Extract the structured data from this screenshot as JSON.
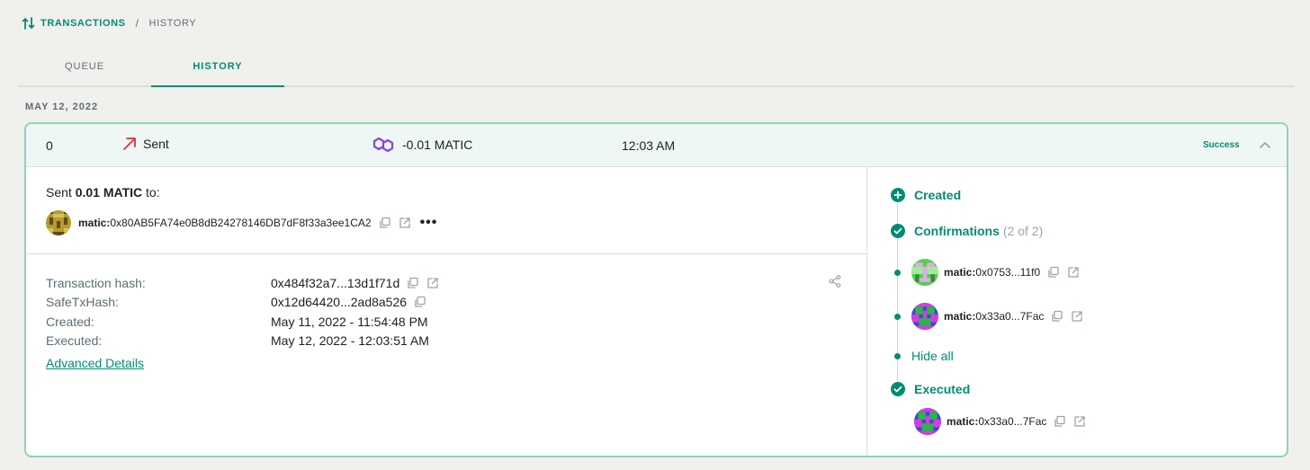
{
  "breadcrumb": {
    "root": "TRANSACTIONS",
    "separator": "/",
    "current": "HISTORY"
  },
  "tabs": [
    {
      "label": "QUEUE"
    },
    {
      "label": "HISTORY"
    }
  ],
  "date_label": "MAY 12, 2022",
  "transaction": {
    "nonce": "0",
    "type": "Sent",
    "amount": "-0.01 MATIC",
    "time": "12:03 AM",
    "status": "Success",
    "sent_prefix": "Sent",
    "sent_amount": "0.01 MATIC",
    "sent_suffix": "to:",
    "recipient_prefix": "matic:",
    "recipient_address": "0x80AB5FA74e0B8dB24278146DB7dF8f33a3ee1CA2",
    "more": "•••",
    "details": [
      {
        "label": "Transaction hash:",
        "value": "0x484f32a7...13d1f71d"
      },
      {
        "label": "SafeTxHash:",
        "value": "0x12d64420...2ad8a526"
      },
      {
        "label": "Created:",
        "value": "May 11, 2022 - 11:54:48 PM"
      },
      {
        "label": "Executed:",
        "value": "May 12, 2022 - 12:03:51 AM"
      }
    ],
    "advanced_link": "Advanced Details"
  },
  "timeline": {
    "created": "Created",
    "confirmations": "Confirmations",
    "confirmations_count": "(2 of 2)",
    "owners": [
      {
        "prefix": "matic:",
        "address": "0x0753...11f0"
      },
      {
        "prefix": "matic:",
        "address": "0x33a0...7Fac"
      }
    ],
    "hide_all": "Hide all",
    "executed": "Executed",
    "executor": {
      "prefix": "matic:",
      "address": "0x33a0...7Fac"
    }
  },
  "colors": {
    "accent": "#008c73",
    "sent_arrow": "#e8303a",
    "polygon": "#8247e5",
    "card_border": "#8ed2c0"
  }
}
